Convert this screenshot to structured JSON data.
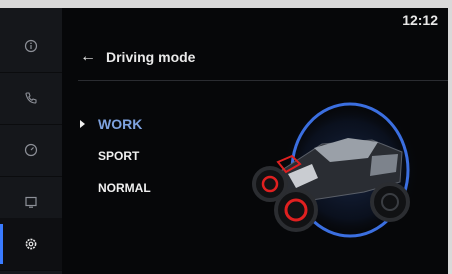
{
  "status": {
    "time": "12:12"
  },
  "sidebar": {
    "items": [
      {
        "icon": "info-icon"
      },
      {
        "icon": "phone-icon"
      },
      {
        "icon": "dashboard-icon"
      },
      {
        "icon": "display-icon"
      },
      {
        "icon": "settings-icon",
        "active": true
      }
    ],
    "accent_color": "#3a7bff"
  },
  "header": {
    "back_icon": "←",
    "title": "Driving mode"
  },
  "modes": {
    "items": [
      {
        "label": "WORK",
        "selected": true
      },
      {
        "label": "SPORT",
        "selected": false
      },
      {
        "label": "NORMAL",
        "selected": false
      }
    ],
    "selected_color": "#7ea2df"
  },
  "vehicle": {
    "image": "atv-illustration",
    "ring_color": "#3b6fe0",
    "accent_color": "#e02020"
  }
}
